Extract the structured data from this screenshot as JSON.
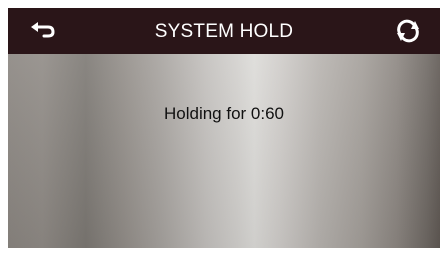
{
  "header": {
    "title": "SYSTEM HOLD",
    "left_icon": "back-arrow-icon",
    "right_icon": "refresh-icon"
  },
  "main": {
    "message": "Holding for 0:60"
  },
  "colors": {
    "title_bar": "#2a1518",
    "title_text": "#ffffff",
    "message_text": "#111111"
  }
}
